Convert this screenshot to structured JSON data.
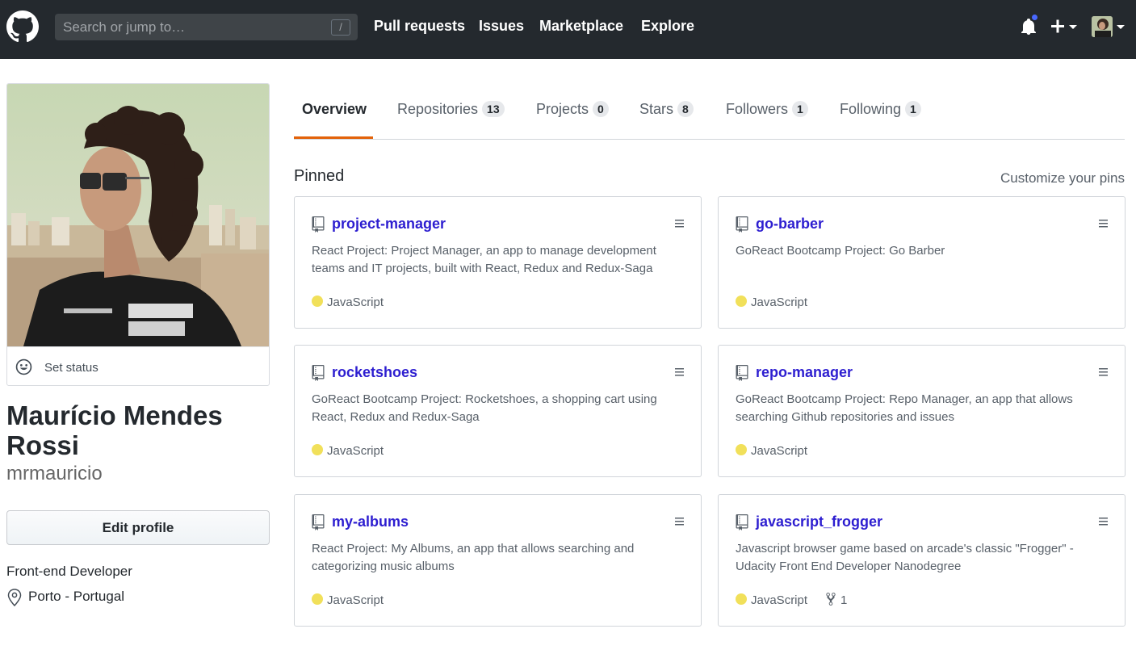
{
  "header": {
    "search_placeholder": "Search or jump to…",
    "search_shortcut": "/",
    "nav": [
      "Pull requests",
      "Issues",
      "Marketplace",
      "Explore"
    ]
  },
  "profile": {
    "set_status": "Set status",
    "full_name": "Maurício Mendes Rossi",
    "username": "mrmauricio",
    "edit_profile": "Edit profile",
    "bio": "Front-end Developer",
    "location": "Porto - Portugal"
  },
  "tabs": [
    {
      "label": "Overview",
      "count": null,
      "selected": true
    },
    {
      "label": "Repositories",
      "count": "13"
    },
    {
      "label": "Projects",
      "count": "0"
    },
    {
      "label": "Stars",
      "count": "8"
    },
    {
      "label": "Followers",
      "count": "1"
    },
    {
      "label": "Following",
      "count": "1"
    }
  ],
  "pinned": {
    "title": "Pinned",
    "customize": "Customize your pins",
    "repos": [
      {
        "name": "project-manager",
        "description": "React Project: Project Manager, an app to manage development teams and IT projects, built with React, Redux and Redux-Saga",
        "language": "JavaScript",
        "forks": null
      },
      {
        "name": "go-barber",
        "description": "GoReact Bootcamp Project: Go Barber",
        "language": "JavaScript",
        "forks": null
      },
      {
        "name": "rocketshoes",
        "description": "GoReact Bootcamp Project: Rocketshoes, a shopping cart using React, Redux and Redux-Saga",
        "language": "JavaScript",
        "forks": null
      },
      {
        "name": "repo-manager",
        "description": "GoReact Bootcamp Project: Repo Manager, an app that allows searching Github repositories and issues",
        "language": "JavaScript",
        "forks": null
      },
      {
        "name": "my-albums",
        "description": "React Project: My Albums, an app that allows searching and categorizing music albums",
        "language": "JavaScript",
        "forks": null
      },
      {
        "name": "javascript_frogger",
        "description": "Javascript browser game based on arcade's classic \"Frogger\" - Udacity Front End Developer Nanodegree",
        "language": "JavaScript",
        "forks": "1"
      }
    ]
  },
  "colors": {
    "header_bg": "#24292e",
    "link": "#2d1ed0",
    "tab_accent": "#e36209",
    "javascript": "#f1e05a",
    "notification": "#4968ff"
  },
  "icons": [
    "github-logo-icon",
    "bell-icon",
    "plus-icon",
    "smiley-icon",
    "location-pin-icon",
    "repo-book-icon",
    "grip-icon",
    "fork-icon"
  ]
}
